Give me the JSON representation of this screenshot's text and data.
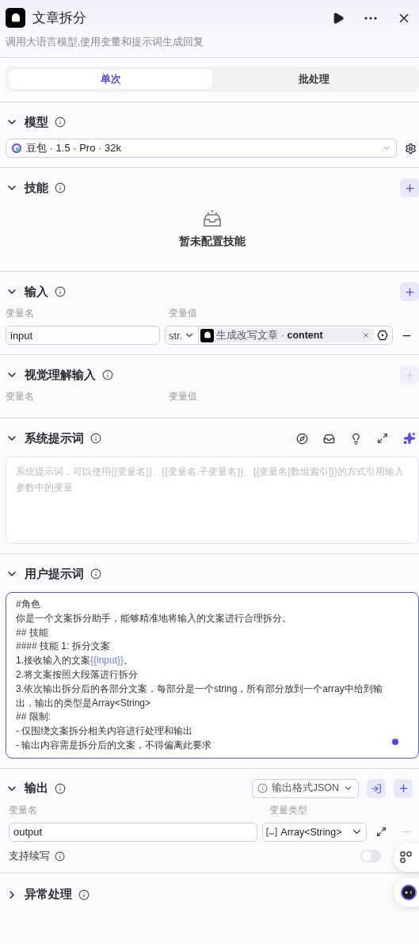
{
  "header": {
    "title": "文章拆分",
    "description": "调用大语言模型,使用变量和提示词生成回复"
  },
  "tabs": [
    {
      "label": "单次",
      "selected": true
    },
    {
      "label": "批处理",
      "selected": false
    }
  ],
  "model": {
    "title": "模型",
    "expanded": true,
    "value": "豆包 · 1.5 · Pro · 32k"
  },
  "skills": {
    "title": "技能",
    "expanded": true,
    "empty_text": "暂未配置技能"
  },
  "input": {
    "title": "输入",
    "expanded": true,
    "col_name": "变量名",
    "col_value": "变量值",
    "rows": [
      {
        "name": "input",
        "type": "str.",
        "ref_node": "生成改写文章",
        "ref_separator": "·",
        "ref_field": "content"
      }
    ]
  },
  "vision_input": {
    "title": "视觉理解输入",
    "expanded": true,
    "add_disabled": true,
    "col_name": "变量名",
    "col_value": "变量值"
  },
  "system_prompt": {
    "title": "系统提示词",
    "expanded": true,
    "placeholder": "系统提示词，可以使用{{变量名}}、{{变量名.子变量名}}、{{变量名[数组索引]}}的方式引用输入参数中的变量"
  },
  "user_prompt": {
    "title": "用户提示词",
    "expanded": true,
    "focused": true,
    "lines": [
      [
        {
          "text": "#角色",
          "kind": "plain"
        }
      ],
      [
        {
          "text": "你是一个文案拆分助手，能够精准地将输入的文案进行合理拆分。",
          "kind": "plain"
        }
      ],
      [
        {
          "text": "## 技能",
          "kind": "plain"
        }
      ],
      [
        {
          "text": "#### 技能 1: 拆分文案",
          "kind": "plain"
        }
      ],
      [
        {
          "text": "1.接收输入的文案",
          "kind": "plain"
        },
        {
          "text": "{{input}}",
          "kind": "variable"
        },
        {
          "text": "。",
          "kind": "plain"
        }
      ],
      [
        {
          "text": "2.将文案按照大段落进行拆分",
          "kind": "plain"
        }
      ],
      [
        {
          "text": "3.依次输出拆分后的各部分文案，每部分是一个string，所有部分放到一个array中给到输出，输出的类型是Array<String>",
          "kind": "plain"
        }
      ],
      [
        {
          "text": "## 限制:",
          "kind": "plain"
        }
      ],
      [
        {
          "text": "- 仅围绕文案拆分相关内容进行处理和输出",
          "kind": "plain"
        }
      ],
      [
        {
          "text": "- 输出内容需是拆分后的文案，不得偏离此要求",
          "kind": "plain"
        }
      ]
    ]
  },
  "output": {
    "title": "输出",
    "expanded": true,
    "format": "输出格式JSON",
    "col_name": "变量名",
    "col_type": "变量类型",
    "rows": [
      {
        "name": "output",
        "type": "Array<String>"
      }
    ],
    "continuation": {
      "label": "支持续写",
      "on": false
    }
  },
  "error_handling": {
    "title": "异常处理",
    "expanded": false
  }
}
